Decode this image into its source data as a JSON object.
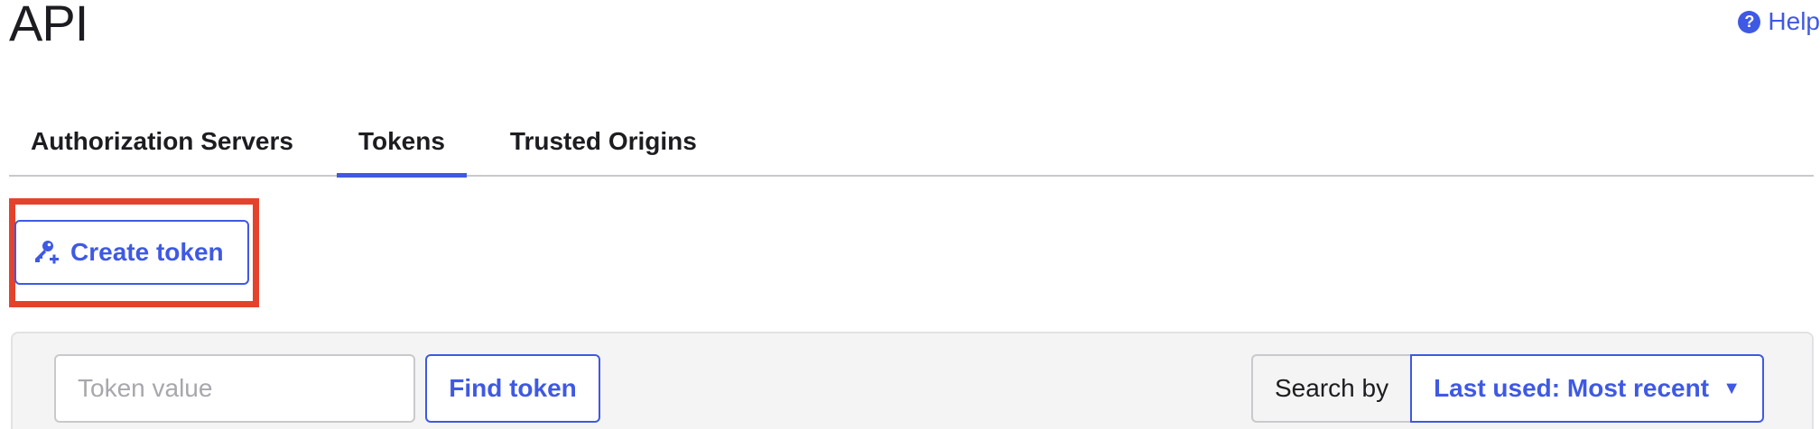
{
  "header": {
    "title": "API",
    "help_label": "Help",
    "help_icon": "question-circle-icon"
  },
  "tabs": [
    {
      "label": "Authorization Servers",
      "active": false
    },
    {
      "label": "Tokens",
      "active": true
    },
    {
      "label": "Trusted Origins",
      "active": false
    }
  ],
  "actions": {
    "create_token_label": "Create token",
    "create_token_icon": "key-plus-icon"
  },
  "search": {
    "token_placeholder": "Token value",
    "token_value": "",
    "find_label": "Find token",
    "search_by_label": "Search by",
    "sort_selected": "Last used: Most recent",
    "sort_icon": "caret-down-icon"
  },
  "colors": {
    "accent": "#3f59e4",
    "highlight": "#e5422c",
    "panel_bg": "#f4f4f4"
  }
}
